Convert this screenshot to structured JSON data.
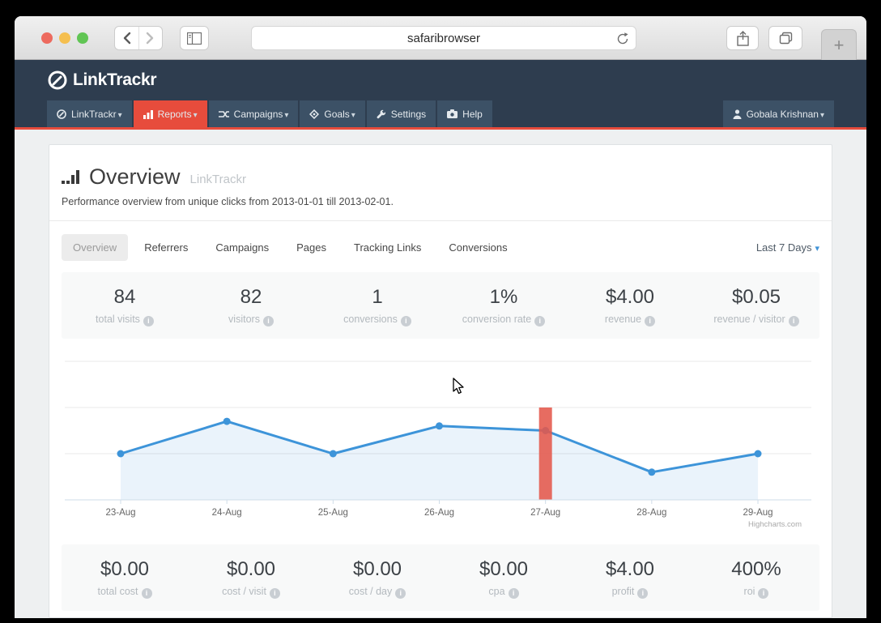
{
  "browser": {
    "url": "safaribrowser",
    "new_tab_label": "+"
  },
  "header": {
    "brand": "LinkTrackr"
  },
  "nav": {
    "items": [
      {
        "label": "LinkTrackr",
        "icon": "link-icon",
        "dropdown": true
      },
      {
        "label": "Reports",
        "icon": "bar-chart-icon",
        "dropdown": true,
        "active": true
      },
      {
        "label": "Campaigns",
        "icon": "shuffle-icon",
        "dropdown": true
      },
      {
        "label": "Goals",
        "icon": "target-icon",
        "dropdown": true
      },
      {
        "label": "Settings",
        "icon": "wrench-icon",
        "dropdown": false
      },
      {
        "label": "Help",
        "icon": "camera-icon",
        "dropdown": false
      }
    ],
    "user": "Gobala Krishnan"
  },
  "page": {
    "title": "Overview",
    "title_suffix": "LinkTrackr",
    "subtitle": "Performance overview from unique clicks from 2013-01-01 till 2013-02-01."
  },
  "tabs": {
    "items": [
      "Overview",
      "Referrers",
      "Campaigns",
      "Pages",
      "Tracking Links",
      "Conversions"
    ],
    "active": "Overview",
    "range_selector": "Last 7 Days"
  },
  "stats_top": [
    {
      "value": "84",
      "label": "total visits"
    },
    {
      "value": "82",
      "label": "visitors"
    },
    {
      "value": "1",
      "label": "conversions"
    },
    {
      "value": "1%",
      "label": "conversion rate"
    },
    {
      "value": "$4.00",
      "label": "revenue"
    },
    {
      "value": "$0.05",
      "label": "revenue / visitor"
    }
  ],
  "stats_bottom": [
    {
      "value": "$0.00",
      "label": "total cost"
    },
    {
      "value": "$0.00",
      "label": "cost / visit"
    },
    {
      "value": "$0.00",
      "label": "cost / day"
    },
    {
      "value": "$0.00",
      "label": "cpa"
    },
    {
      "value": "$4.00",
      "label": "profit"
    },
    {
      "value": "400%",
      "label": "roi"
    }
  ],
  "chart_data": {
    "type": "line",
    "x": [
      "23-Aug",
      "24-Aug",
      "25-Aug",
      "26-Aug",
      "27-Aug",
      "28-Aug",
      "29-Aug"
    ],
    "series": [
      {
        "name": "visits",
        "type": "area-line",
        "color": "#3d94d9",
        "values": [
          10,
          17,
          10,
          16,
          15,
          6,
          10
        ]
      },
      {
        "name": "highlight-column",
        "type": "column",
        "color": "#e4584b",
        "values": [
          null,
          null,
          null,
          null,
          20,
          null,
          null
        ]
      }
    ],
    "ylim": [
      0,
      30
    ],
    "grid": true,
    "legend": "none",
    "credits": "Highcharts.com"
  }
}
